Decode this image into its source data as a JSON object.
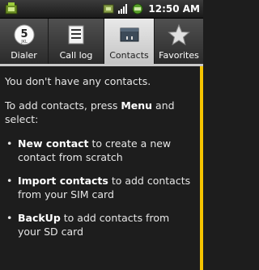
{
  "status_bar": {
    "time": "12:50 AM",
    "icons": [
      "notification-icon",
      "usb-icon",
      "signal-icon",
      "battery-icon"
    ]
  },
  "tabs": [
    {
      "label": "Dialer",
      "icon": "dialer-icon",
      "selected": false
    },
    {
      "label": "Call log",
      "icon": "call-log-icon",
      "selected": false
    },
    {
      "label": "Contacts",
      "icon": "contacts-icon",
      "selected": true
    },
    {
      "label": "Favorites",
      "icon": "star-icon",
      "selected": false
    }
  ],
  "content": {
    "empty_message": "You don't have any contacts.",
    "instruction_pre": "To add contacts, press ",
    "instruction_bold": "Menu",
    "instruction_post": " and select:",
    "bullets": [
      {
        "bold": "New contact",
        "rest": " to create a new contact from scratch"
      },
      {
        "bold": "Import contacts",
        "rest": " to add contacts from your SIM card"
      },
      {
        "bold": "BackUp",
        "rest": " to add contacts from your SD card"
      }
    ]
  },
  "colors": {
    "accent_scrollbar": "#f5c400",
    "background": "#1d1d1d",
    "selected_tab": "#d9d9d9"
  }
}
